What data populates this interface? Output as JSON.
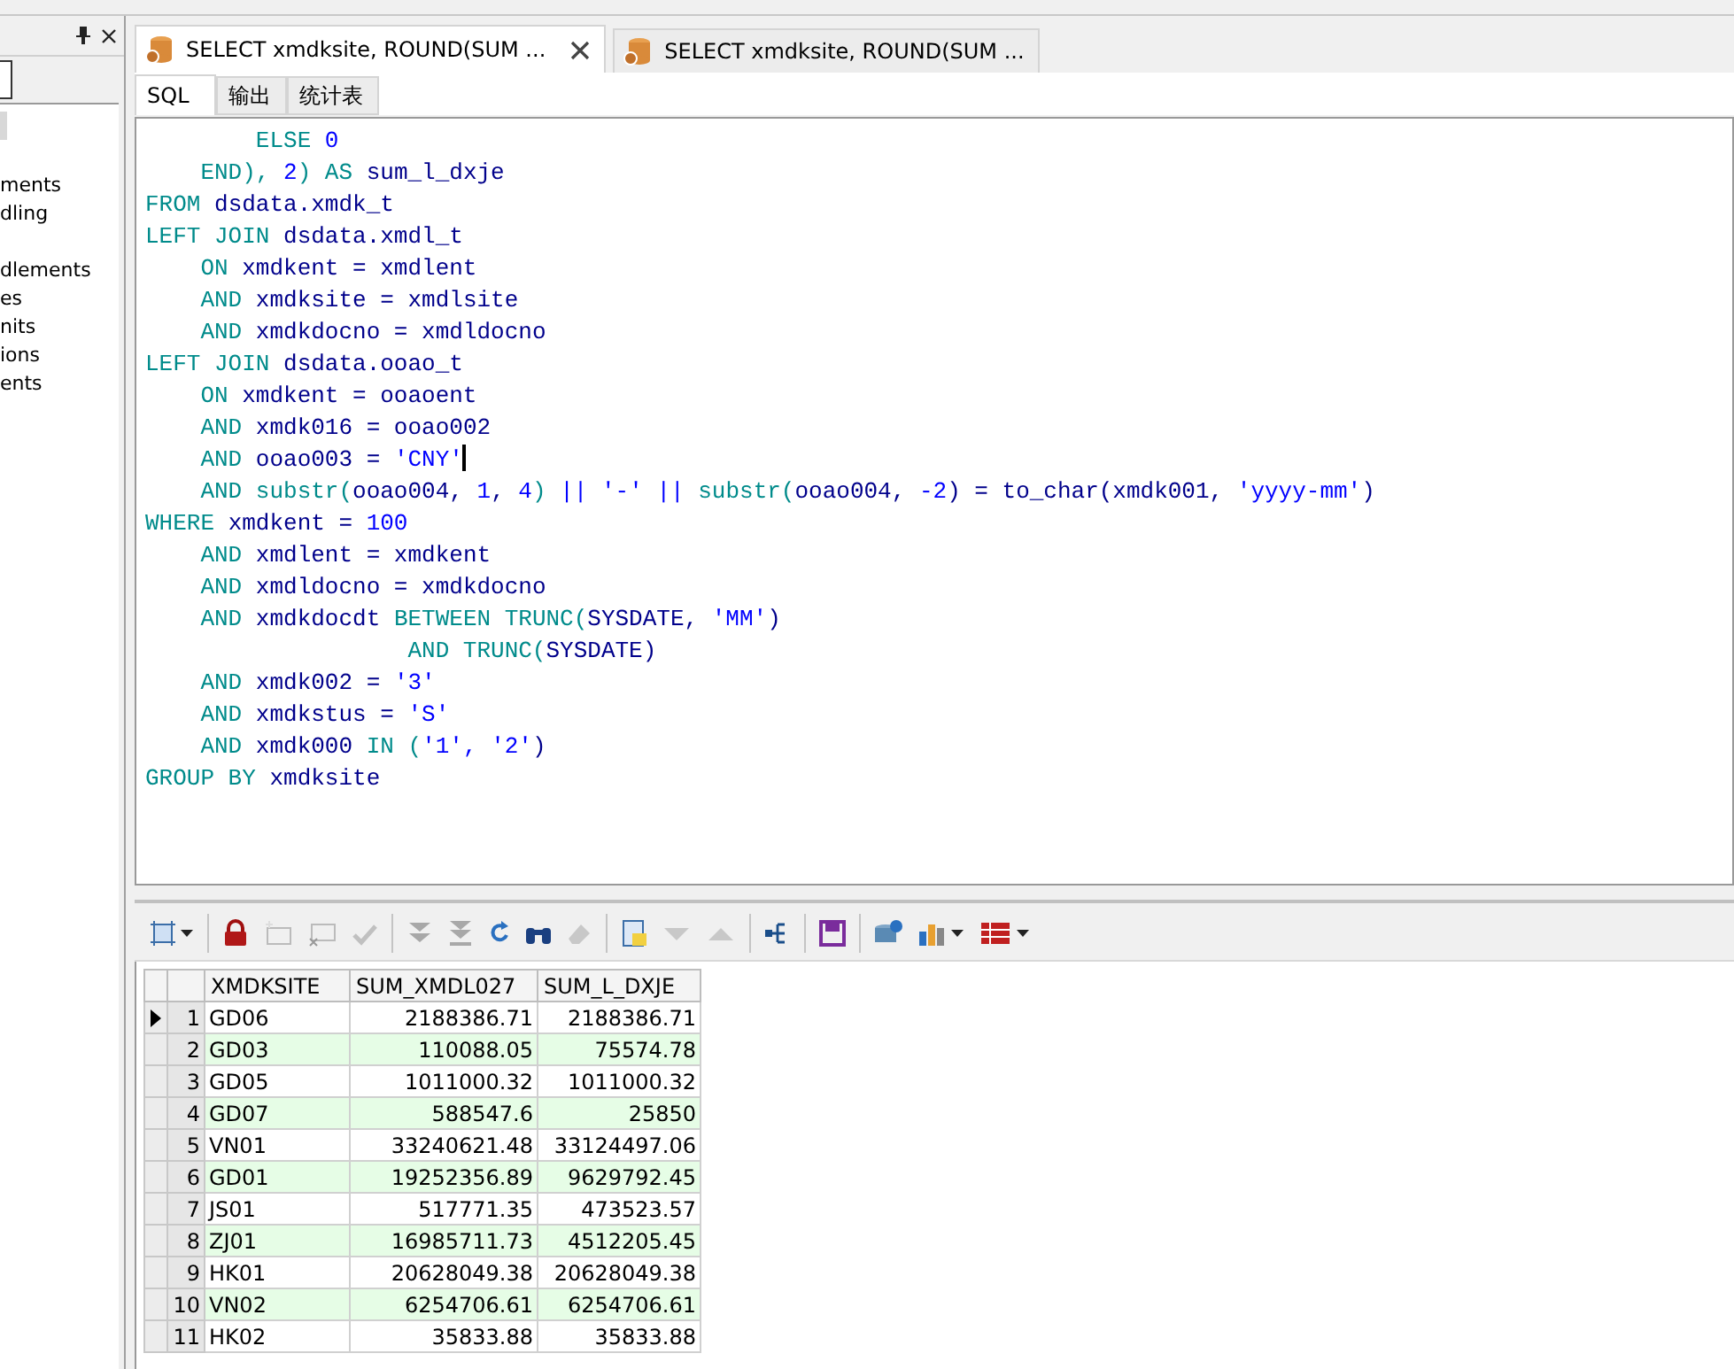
{
  "left_panel": {
    "groups": [
      [
        "ments",
        "dling"
      ],
      [
        "dlements",
        "es",
        "nits",
        "ions",
        "ents"
      ]
    ]
  },
  "tabs": [
    {
      "label": "SELECT xmdksite, ROUND(SUM ...",
      "selected": true,
      "closable": true
    },
    {
      "label": "SELECT xmdksite, ROUND(SUM ...",
      "selected": false,
      "closable": false
    }
  ],
  "subtabs": [
    {
      "label": "SQL",
      "selected": true
    },
    {
      "label": "输出",
      "selected": false
    },
    {
      "label": "统计表",
      "selected": false
    }
  ],
  "sql_lines": [
    [
      {
        "t": "        ELSE ",
        "kind": "kw"
      },
      {
        "t": "0",
        "kind": "lit"
      }
    ],
    [
      {
        "t": "    END), ",
        "kind": "kw"
      },
      {
        "t": "2",
        "kind": "lit"
      },
      {
        "t": ") AS ",
        "kind": "kw"
      },
      {
        "t": "sum_l_dxje",
        "kind": "id"
      }
    ],
    [
      {
        "t": "FROM ",
        "kind": "kw"
      },
      {
        "t": "dsdata.xmdk_t",
        "kind": "id"
      }
    ],
    [
      {
        "t": "LEFT JOIN ",
        "kind": "kw"
      },
      {
        "t": "dsdata.xmdl_t",
        "kind": "id"
      }
    ],
    [
      {
        "t": "    ON ",
        "kind": "kw"
      },
      {
        "t": "xmdkent = xmdlent",
        "kind": "id"
      }
    ],
    [
      {
        "t": "    AND ",
        "kind": "kw"
      },
      {
        "t": "xmdksite = xmdlsite",
        "kind": "id"
      }
    ],
    [
      {
        "t": "    AND ",
        "kind": "kw"
      },
      {
        "t": "xmdkdocno = xmdldocno",
        "kind": "id"
      }
    ],
    [
      {
        "t": "LEFT JOIN ",
        "kind": "kw"
      },
      {
        "t": "dsdata.ooao_t",
        "kind": "id"
      }
    ],
    [
      {
        "t": "    ON ",
        "kind": "kw"
      },
      {
        "t": "xmdkent = ooaoent",
        "kind": "id"
      }
    ],
    [
      {
        "t": "    AND ",
        "kind": "kw"
      },
      {
        "t": "xmdk016 = ooao002",
        "kind": "id"
      }
    ],
    [
      {
        "t": "    AND ",
        "kind": "kw"
      },
      {
        "t": "ooao003 = ",
        "kind": "id"
      },
      {
        "t": "'CNY'",
        "kind": "lit"
      }
    ],
    [
      {
        "t": "    AND substr(",
        "kind": "kw"
      },
      {
        "t": "ooao004, ",
        "kind": "id"
      },
      {
        "t": "1",
        "kind": "lit"
      },
      {
        "t": ", ",
        "kind": "id"
      },
      {
        "t": "4",
        "kind": "lit"
      },
      {
        "t": ") ",
        "kind": "kw"
      },
      {
        "t": "|| '-' ||",
        "kind": "lit"
      },
      {
        "t": " substr(",
        "kind": "kw"
      },
      {
        "t": "ooao004, ",
        "kind": "id"
      },
      {
        "t": "-2",
        "kind": "lit"
      },
      {
        "t": ") = to_char(xmdk001, ",
        "kind": "id"
      },
      {
        "t": "'yyyy-mm'",
        "kind": "lit"
      },
      {
        "t": ")",
        "kind": "id"
      }
    ],
    [
      {
        "t": "WHERE ",
        "kind": "kw"
      },
      {
        "t": "xmdkent = ",
        "kind": "id"
      },
      {
        "t": "100",
        "kind": "lit"
      }
    ],
    [
      {
        "t": "    AND ",
        "kind": "kw"
      },
      {
        "t": "xmdlent = xmdkent",
        "kind": "id"
      }
    ],
    [
      {
        "t": "    AND ",
        "kind": "kw"
      },
      {
        "t": "xmdldocno = xmdkdocno",
        "kind": "id"
      }
    ],
    [
      {
        "t": "    AND ",
        "kind": "kw"
      },
      {
        "t": "xmdkdocdt ",
        "kind": "id"
      },
      {
        "t": "BETWEEN TRUNC(",
        "kind": "kw"
      },
      {
        "t": "SYSDATE, ",
        "kind": "id"
      },
      {
        "t": "'MM'",
        "kind": "lit"
      },
      {
        "t": ")",
        "kind": "id"
      }
    ],
    [
      {
        "t": "                   AND TRUNC(",
        "kind": "kw"
      },
      {
        "t": "SYSDATE)",
        "kind": "id"
      }
    ],
    [
      {
        "t": "    AND ",
        "kind": "kw"
      },
      {
        "t": "xmdk002 = ",
        "kind": "id"
      },
      {
        "t": "'3'",
        "kind": "lit"
      }
    ],
    [
      {
        "t": "    AND ",
        "kind": "kw"
      },
      {
        "t": "xmdkstus = ",
        "kind": "id"
      },
      {
        "t": "'S'",
        "kind": "lit"
      }
    ],
    [
      {
        "t": "    AND ",
        "kind": "kw"
      },
      {
        "t": "xmdk000 ",
        "kind": "id"
      },
      {
        "t": "IN (",
        "kind": "kw"
      },
      {
        "t": "'1', '2'",
        "kind": "lit"
      },
      {
        "t": ")",
        "kind": "id"
      }
    ],
    [
      {
        "t": "GROUP BY ",
        "kind": "kw"
      },
      {
        "t": "xmdksite",
        "kind": "id"
      }
    ]
  ],
  "grid": {
    "columns": [
      "XMDKSITE",
      "SUM_XMDL027",
      "SUM_L_DXJE"
    ],
    "rows": [
      {
        "num": "1",
        "current": true,
        "cells": [
          "GD06",
          "2188386.71",
          "2188386.71"
        ]
      },
      {
        "num": "2",
        "current": false,
        "cells": [
          "GD03",
          "110088.05",
          "75574.78"
        ]
      },
      {
        "num": "3",
        "current": false,
        "cells": [
          "GD05",
          "1011000.32",
          "1011000.32"
        ]
      },
      {
        "num": "4",
        "current": false,
        "cells": [
          "GD07",
          "588547.6",
          "25850"
        ]
      },
      {
        "num": "5",
        "current": false,
        "cells": [
          "VN01",
          "33240621.48",
          "33124497.06"
        ]
      },
      {
        "num": "6",
        "current": false,
        "cells": [
          "GD01",
          "19252356.89",
          "9629792.45"
        ]
      },
      {
        "num": "7",
        "current": false,
        "cells": [
          "JS01",
          "517771.35",
          "473523.57"
        ]
      },
      {
        "num": "8",
        "current": false,
        "cells": [
          "ZJ01",
          "16985711.73",
          "4512205.45"
        ]
      },
      {
        "num": "9",
        "current": false,
        "cells": [
          "HK01",
          "20628049.38",
          "20628049.38"
        ]
      },
      {
        "num": "10",
        "current": false,
        "cells": [
          "VN02",
          "6254706.61",
          "6254706.61"
        ]
      },
      {
        "num": "11",
        "current": false,
        "cells": [
          "HK02",
          "35833.88",
          "35833.88"
        ]
      }
    ]
  }
}
